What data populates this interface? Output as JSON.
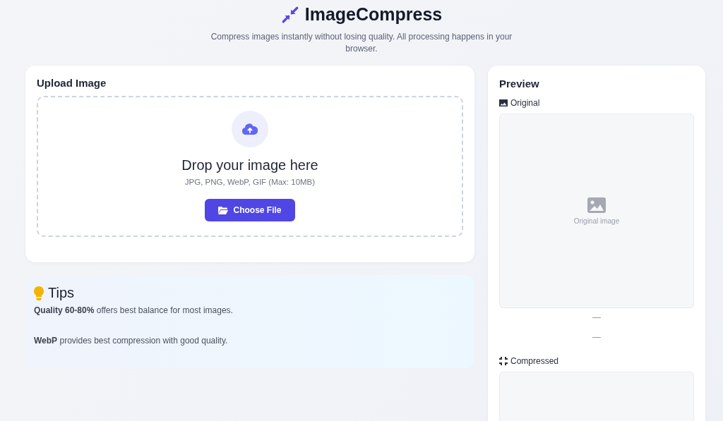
{
  "header": {
    "title": "ImageCompress",
    "subtitle": "Compress images instantly without losing quality. All processing happens in your browser."
  },
  "upload": {
    "title": "Upload Image",
    "drop_text": "Drop your image here",
    "formats": "JPG, PNG, WebP, GIF (Max: 10MB)",
    "button": "Choose File"
  },
  "tips": {
    "title": "Tips",
    "items": [
      "**Quality 60-80%** offers best balance for most images.",
      "**WebP** provides best compression with good quality."
    ]
  },
  "preview": {
    "title": "Preview",
    "original": {
      "label": "Original",
      "placeholder": "Original image",
      "size": "—",
      "detail": "—"
    },
    "compressed": {
      "label": "Compressed"
    }
  }
}
